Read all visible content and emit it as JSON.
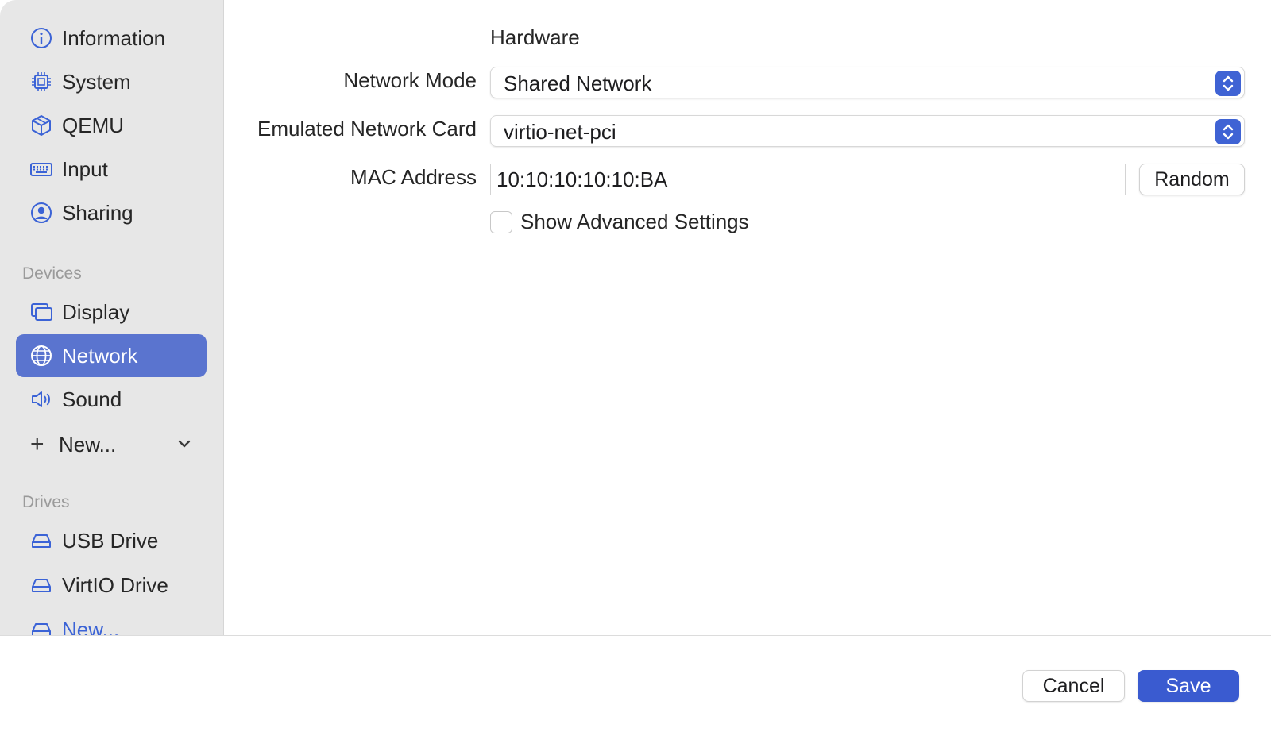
{
  "sidebar": {
    "items": [
      {
        "label": "Information",
        "icon": "info-icon"
      },
      {
        "label": "System",
        "icon": "cpu-icon"
      },
      {
        "label": "QEMU",
        "icon": "cube-icon"
      },
      {
        "label": "Input",
        "icon": "keyboard-icon"
      },
      {
        "label": "Sharing",
        "icon": "person-circle-icon"
      }
    ],
    "devices_header": "Devices",
    "devices": [
      {
        "label": "Display",
        "icon": "display-icon"
      },
      {
        "label": "Network",
        "icon": "globe-icon",
        "selected": true
      },
      {
        "label": "Sound",
        "icon": "speaker-icon"
      }
    ],
    "new_device_label": "New...",
    "drives_header": "Drives",
    "drives": [
      {
        "label": "USB Drive",
        "icon": "drive-icon"
      },
      {
        "label": "VirtIO Drive",
        "icon": "drive-icon"
      },
      {
        "label": "New...",
        "icon": "drive-add-icon"
      }
    ]
  },
  "main": {
    "heading": "Hardware",
    "network_mode": {
      "label": "Network Mode",
      "value": "Shared Network"
    },
    "emulated_card": {
      "label": "Emulated Network Card",
      "value": "virtio-net-pci"
    },
    "mac_address": {
      "label": "MAC Address",
      "value": "10:10:10:10:10:BA"
    },
    "random_button": "Random",
    "advanced_checkbox": {
      "label": "Show Advanced Settings",
      "checked": false
    }
  },
  "footer": {
    "cancel": "Cancel",
    "save": "Save"
  },
  "colors": {
    "accent": "#3a5bd0",
    "selected_row": "#5a74cf",
    "icon_blue": "#3b63d6"
  }
}
